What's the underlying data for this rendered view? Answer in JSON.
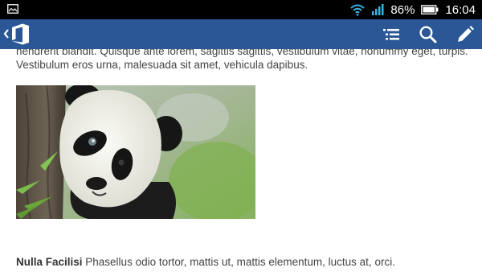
{
  "status_bar": {
    "battery": "86%",
    "time": "16:04",
    "icons": [
      "image-notification-icon",
      "wifi-icon",
      "signal-icon",
      "battery-icon"
    ]
  },
  "app_bar": {
    "color": "#2b5797",
    "actions": [
      "navigation-list-icon",
      "search-icon",
      "edit-pencil-icon"
    ]
  },
  "document": {
    "paragraph_1_line_1": "hendrerit blandit. Quisque ante lorem, sagittis sagittis, vestibulum vitae, nonummy eget, turpis.",
    "paragraph_1_line_2": "Vestibulum eros urna, malesuada sit amet, vehicula dapibus.",
    "image_subject": "panda",
    "paragraph_2_bold": "Nulla Facilisi",
    "paragraph_2_text": " Phasellus odio tortor, mattis ut, mattis elementum, luctus at, orci."
  }
}
